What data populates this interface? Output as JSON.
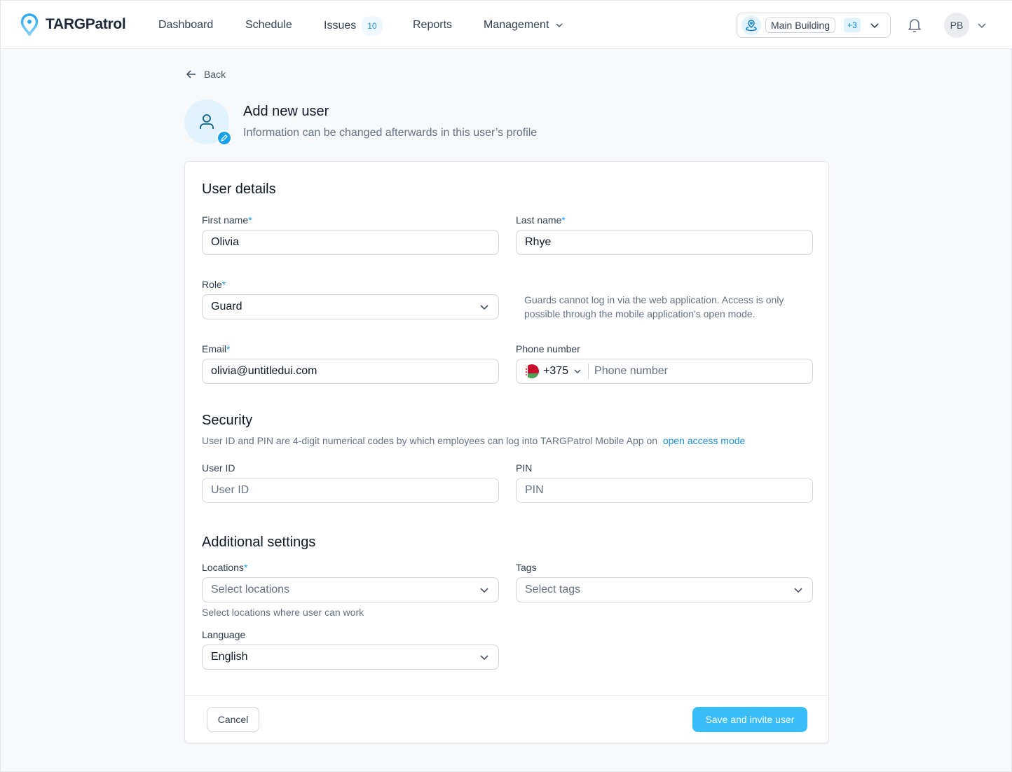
{
  "nav": {
    "brand": "TARGPatrol",
    "items": [
      {
        "label": "Dashboard"
      },
      {
        "label": "Schedule"
      },
      {
        "label": "Issues",
        "badge": "10"
      },
      {
        "label": "Reports"
      },
      {
        "label": "Management"
      }
    ],
    "location": {
      "name": "Main Building",
      "extra": "+3"
    },
    "avatar": "PB"
  },
  "header": {
    "back": "Back",
    "title": "Add new user",
    "subtitle": "Information can be changed afterwards in this user’s profile"
  },
  "form": {
    "user_details": "User details",
    "first_name": {
      "label": "First name",
      "value": "Olivia"
    },
    "last_name": {
      "label": "Last name",
      "value": "Rhye"
    },
    "role": {
      "label": "Role",
      "value": "Guard",
      "note": "Guards cannot log in via the web application. Access is only possible through the mobile application's open mode."
    },
    "email": {
      "label": "Email",
      "value": "olivia@untitledui.com"
    },
    "phone": {
      "label": "Phone number",
      "code": "+375",
      "placeholder": "Phone number"
    },
    "security": "Security",
    "security_desc": "User ID and PIN are 4-digit numerical codes by which employees can log into TARGPatrol Mobile App on",
    "security_link": "open access mode",
    "user_id": {
      "label": "User ID",
      "placeholder": "User ID"
    },
    "pin": {
      "label": "PIN",
      "placeholder": "PIN"
    },
    "additional": "Additional settings",
    "locations": {
      "label": "Locations",
      "placeholder": "Select locations",
      "hint": "Select locations where user can work"
    },
    "tags": {
      "label": "Tags",
      "placeholder": "Select tags"
    },
    "language": {
      "label": "Language",
      "value": "English"
    },
    "required_mark": "*",
    "cancel": "Cancel",
    "save": "Save and invite user"
  },
  "colors": {
    "accent": "#38bdf8",
    "link": "#1a8fd6"
  }
}
